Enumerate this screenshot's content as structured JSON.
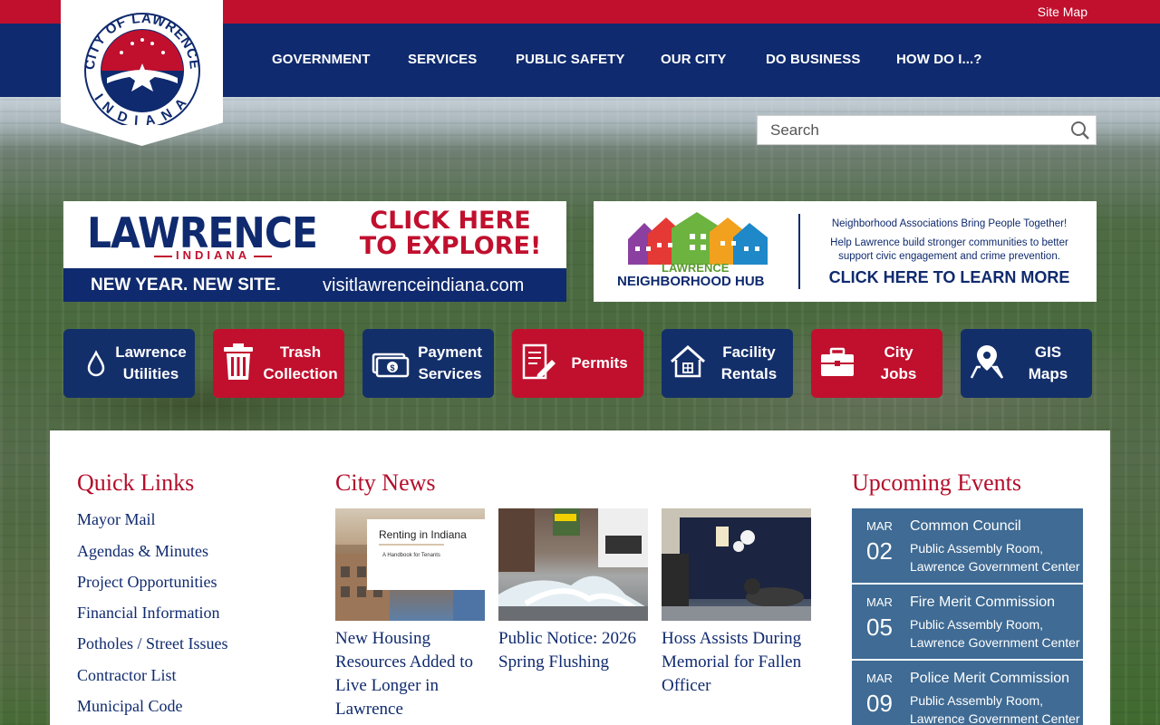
{
  "header": {
    "site_map": "Site Map",
    "nav": [
      "GOVERNMENT",
      "SERVICES",
      "PUBLIC SAFETY",
      "OUR CITY",
      "DO BUSINESS",
      "HOW DO I...?"
    ],
    "logo": {
      "text_top": "CITY OF LAWRENCE",
      "text_bottom": "INDIANA"
    }
  },
  "search": {
    "placeholder": "Search"
  },
  "banners": {
    "left": {
      "word": "LAWRENCE",
      "sub": "INDIANA",
      "cta_line1": "CLICK HERE",
      "cta_line2": "TO EXPLORE!",
      "strip_a": "NEW YEAR. NEW SITE.",
      "strip_b": "visitlawrenceindiana.com"
    },
    "right": {
      "hub_line1": "LAWRENCE",
      "hub_line2": "NEIGHBORHOOD HUB",
      "r1": "Neighborhood Associations Bring People Together!",
      "r2a": "Help Lawrence build stronger communities to better",
      "r2b": "support civic engagement and crime prevention.",
      "r3": "CLICK HERE TO LEARN MORE"
    }
  },
  "tiles": [
    {
      "l1": "Lawrence",
      "l2": "Utilities",
      "icon": "water-drop-icon"
    },
    {
      "l1": "Trash",
      "l2": "Collection",
      "icon": "trash-can-icon"
    },
    {
      "l1": "Payment",
      "l2": "Services",
      "icon": "money-icon"
    },
    {
      "l1": "Permits",
      "l2": "",
      "icon": "document-pen-icon"
    },
    {
      "l1": "Facility",
      "l2": "Rentals",
      "icon": "house-icon"
    },
    {
      "l1": "City",
      "l2": "Jobs",
      "icon": "briefcase-icon"
    },
    {
      "l1": "GIS",
      "l2": "Maps",
      "icon": "map-pin-icon"
    }
  ],
  "quick_links": {
    "title": "Quick Links",
    "items": [
      "Mayor Mail",
      "Agendas & Minutes",
      "Project Opportunities",
      "Financial Information",
      "Potholes / Street Issues",
      "Contractor List",
      "Municipal Code"
    ]
  },
  "news": {
    "title": "City News",
    "items": [
      {
        "title": "New Housing Resources Added to Live Longer in Lawrence",
        "img_text1": "Renting in Indiana",
        "img_text2": "A Handbook for Tenants"
      },
      {
        "title": "Public Notice: 2026 Spring Flushing"
      },
      {
        "title": "Hoss Assists During Memorial for Fallen Officer"
      }
    ]
  },
  "events": {
    "title": "Upcoming Events",
    "items": [
      {
        "month": "MAR",
        "day": "02",
        "title": "Common Council",
        "loc1": "Public Assembly Room,",
        "loc2": "Lawrence Government Center"
      },
      {
        "month": "MAR",
        "day": "05",
        "title": "Fire Merit Commission",
        "loc1": "Public Assembly Room,",
        "loc2": "Lawrence Government Center"
      },
      {
        "month": "MAR",
        "day": "09",
        "title": "Police Merit Commission",
        "loc1": "Public Assembly Room,",
        "loc2": "Lawrence Government Center"
      }
    ]
  },
  "colors": {
    "red": "#c0102e",
    "navy": "#0f2a6e",
    "event_blue": "#3f6b94"
  }
}
